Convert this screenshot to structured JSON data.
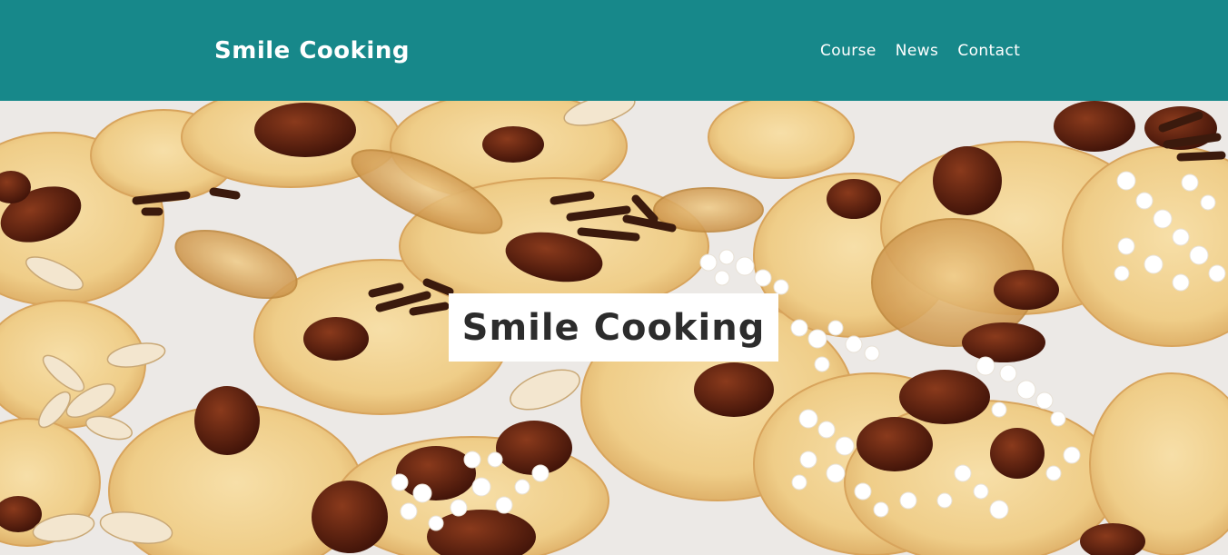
{
  "header": {
    "logo": "Smile Cooking",
    "nav": [
      {
        "label": "Course"
      },
      {
        "label": "News"
      },
      {
        "label": "Contact"
      }
    ],
    "background_color": "#17888a"
  },
  "hero": {
    "title": "Smile Cooking",
    "image_subject": "photo of rabbit-shaped cookies topped with raisins, chocolate sprinkles, sliced almonds and pearl sugar"
  }
}
